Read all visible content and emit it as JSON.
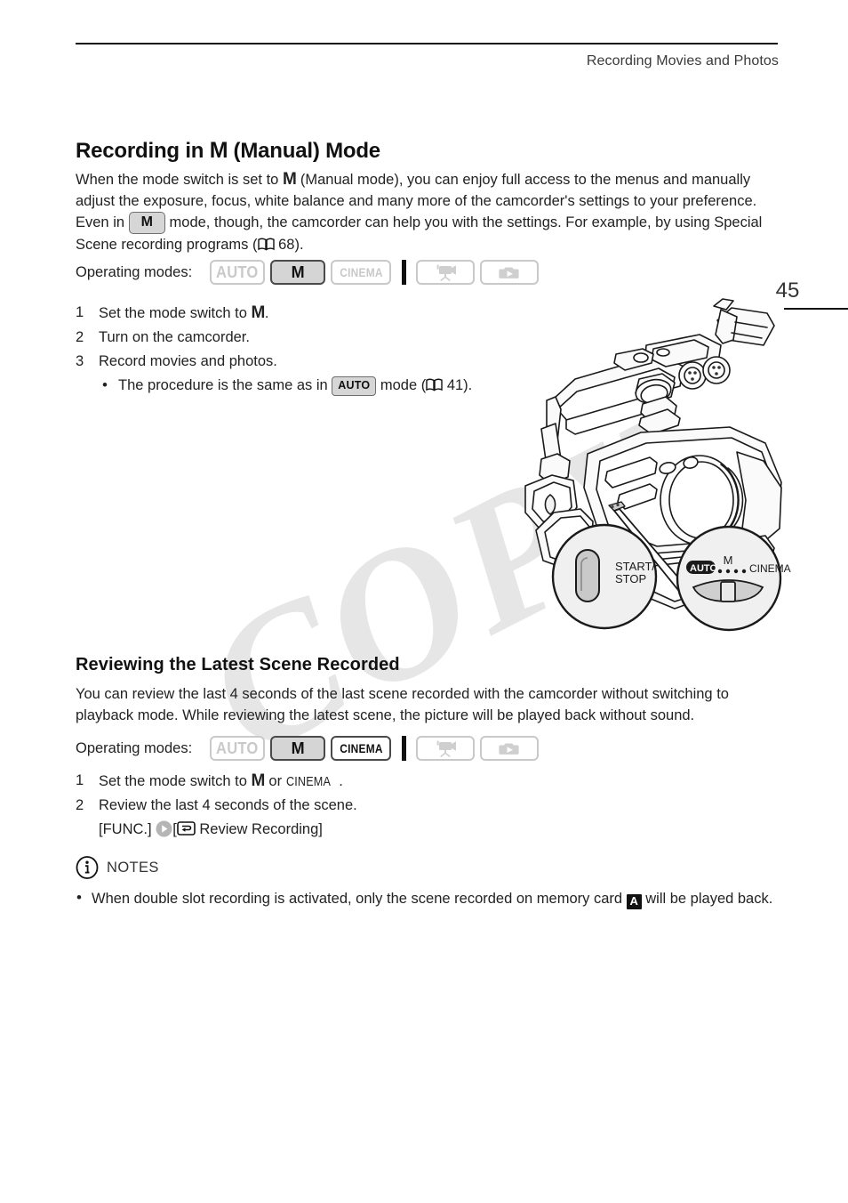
{
  "header": {
    "title": "Recording Movies and Photos",
    "page_number": "45"
  },
  "watermark": {
    "text": "COPY"
  },
  "section1": {
    "title_prefix": "Recording in ",
    "title_mode": "M",
    "title_suffix": " (Manual) Mode",
    "paragraph_part1": "When the mode switch is set to ",
    "paragraph_mode1": "M",
    "paragraph_part2": " (Manual mode), you can enjoy full access to the menus and manually adjust the exposure, focus, white balance and many more of the camcorder's settings to your preference. Even in ",
    "paragraph_badge": "M",
    "paragraph_part3": " mode, though, the camcorder can help you with the settings. For example, by using Special Scene recording programs (",
    "paragraph_page_ref": " 68).",
    "operating_modes_label": "Operating modes:",
    "modes": [
      {
        "label": "AUTO",
        "state": "inactive",
        "name": "mode-chip-auto"
      },
      {
        "label": "M",
        "state": "active",
        "name": "mode-chip-manual"
      },
      {
        "label": "CINEMA",
        "state": "inactive",
        "name": "mode-chip-cinema"
      }
    ],
    "playback_modes": [
      {
        "icon": "movie-playback-icon",
        "state": "inactive"
      },
      {
        "icon": "photo-playback-icon",
        "state": "inactive"
      }
    ],
    "steps": [
      {
        "num": "1",
        "text_before": "Set the mode switch to ",
        "mode": "M",
        "text_after": "."
      },
      {
        "num": "2",
        "text_before": "Turn on the camcorder.",
        "mode": "",
        "text_after": ""
      },
      {
        "num": "3",
        "text_before": "Record movies and photos.",
        "mode": "",
        "text_after": ""
      }
    ],
    "substep_before": "The procedure is the same as in ",
    "substep_badge": "AUTO",
    "substep_after": " mode (",
    "substep_page_ref": " 41)."
  },
  "illustration": {
    "callout_left_label_line1": "START/",
    "callout_left_label_line2": "STOP",
    "switch_auto": "AUTO",
    "switch_m": "M",
    "switch_cinema": "CINEMA"
  },
  "section2": {
    "title": "Reviewing the Latest Scene Recorded",
    "paragraph": "You can review the last 4 seconds of the last scene recorded with the camcorder without switching to playback mode. While reviewing the latest scene, the picture will be played back without sound.",
    "operating_modes_label": "Operating modes:",
    "modes": [
      {
        "label": "AUTO",
        "state": "inactive",
        "name": "mode-chip-auto"
      },
      {
        "label": "M",
        "state": "active",
        "name": "mode-chip-manual"
      },
      {
        "label": "CINEMA",
        "state": "active-outline",
        "name": "mode-chip-cinema"
      }
    ],
    "playback_modes": [
      {
        "icon": "movie-playback-icon",
        "state": "inactive"
      },
      {
        "icon": "photo-playback-icon",
        "state": "inactive"
      }
    ],
    "step1_before": "Set the mode switch to ",
    "step1_mode": "M",
    "step1_mid": " or ",
    "step1_cinema": "CINEMA",
    "step1_after": ".",
    "step2": "Review the last 4 seconds of the scene.",
    "step2_detail_func": "[FUNC.]",
    "step2_detail_menu": "[",
    "step2_detail_menu_text": " Review Recording]"
  },
  "notes": {
    "label": "NOTES",
    "items": [
      {
        "text_before": "When double slot recording is activated, only the scene recorded on memory card ",
        "card": "A",
        "text_after": " will be played back."
      }
    ]
  }
}
